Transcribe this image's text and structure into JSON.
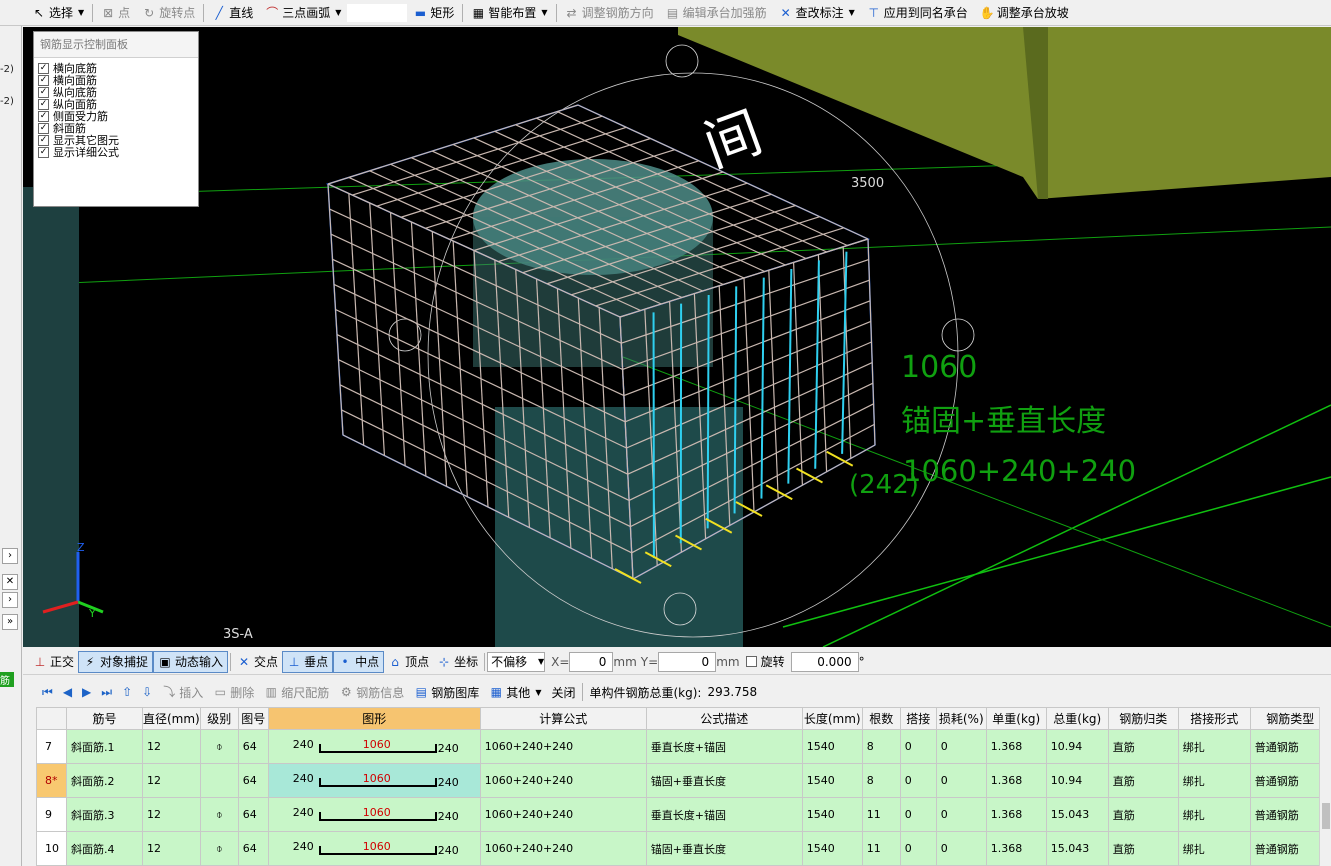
{
  "toolbar": {
    "select": "选择",
    "point": "点",
    "rotate_point": "旋转点",
    "line": "直线",
    "arc3": "三点画弧",
    "rect": "矩形",
    "smart_layout": "智能布置",
    "adjust_dir": "调整钢筋方向",
    "edit_cap_rebar": "编辑承台加强筋",
    "check_label": "查改标注",
    "apply_same": "应用到同名承台",
    "adjust_slope": "调整承台放坡"
  },
  "left_strip": {
    "stub1": "-2)",
    "stub2": "-2)",
    "stub3": "筋"
  },
  "panel": {
    "title": "钢筋显示控制面板",
    "items": [
      {
        "label": "横向底筋",
        "checked": true
      },
      {
        "label": "横向面筋",
        "checked": true
      },
      {
        "label": "纵向底筋",
        "checked": true
      },
      {
        "label": "纵向面筋",
        "checked": true
      },
      {
        "label": "侧面受力筋",
        "checked": true
      },
      {
        "label": "斜面筋",
        "checked": true
      },
      {
        "label": "显示其它图元",
        "checked": true
      },
      {
        "label": "显示详细公式",
        "checked": true
      }
    ]
  },
  "viewport": {
    "dim_label": "3500",
    "ann_length": "1060",
    "ann_desc": "锚固+垂直长度",
    "ann_formula": "1060+240+240",
    "ann_overlap": "(242)",
    "axis_label": "3S-A",
    "axis_z": "Z",
    "axis_y": "Y",
    "colors": {
      "rebar": "#c9b8b0",
      "highlight_rebar": "#2fd0f0",
      "box_edge": "#1a5ee0",
      "yellow": "#f0e020",
      "green_line": "#10c010",
      "column": "#1e4a4a",
      "olive_block": "#7a8a2a",
      "annotation": "#10a010"
    }
  },
  "snapbar": {
    "ortho": "正交",
    "obj_snap": "对象捕捉",
    "dyn_input": "动态输入",
    "intersection": "交点",
    "perp": "垂点",
    "mid": "中点",
    "vertex": "顶点",
    "coord": "坐标",
    "offset": "不偏移",
    "x_label": "X=",
    "x_val": "0",
    "mm1": "mm",
    "y_label": "Y=",
    "y_val": "0",
    "mm2": "mm",
    "rotate": "旋转",
    "rotate_val": "0.000",
    "deg": "°"
  },
  "navbar": {
    "insert": "插入",
    "delete": "删除",
    "scale_rebar": "缩尺配筋",
    "rebar_info": "钢筋信息",
    "rebar_lib": "钢筋图库",
    "other": "其他",
    "close": "关闭",
    "total_label": "单构件钢筋总重(kg):",
    "total_value": "293.758"
  },
  "table": {
    "headers": [
      "",
      "筋号",
      "直径(mm)",
      "级别",
      "图号",
      "图形",
      "计算公式",
      "公式描述",
      "长度(mm)",
      "根数",
      "搭接",
      "损耗(%)",
      "单重(kg)",
      "总重(kg)",
      "钢筋归类",
      "搭接形式",
      "钢筋类型"
    ],
    "rows": [
      {
        "num": "7",
        "name": "斜面筋.1",
        "dia": "12",
        "grade": "⌽",
        "fig": "64",
        "s_left": "240",
        "s_mid": "1060",
        "s_right": "240",
        "formula": "1060+240+240",
        "desc": "垂直长度+锚固",
        "length": "1540",
        "count": "8",
        "lap": "0",
        "loss": "0",
        "unit_w": "1.368",
        "total_w": "10.94",
        "category": "直筋",
        "lap_type": "绑扎",
        "type": "普通钢筋",
        "current": false
      },
      {
        "num": "8*",
        "name": "斜面筋.2",
        "dia": "12",
        "grade": "",
        "fig": "64",
        "s_left": "240",
        "s_mid": "1060",
        "s_right": "240",
        "formula": "1060+240+240",
        "desc": "锚固+垂直长度",
        "length": "1540",
        "count": "8",
        "lap": "0",
        "loss": "0",
        "unit_w": "1.368",
        "total_w": "10.94",
        "category": "直筋",
        "lap_type": "绑扎",
        "type": "普通钢筋",
        "current": true
      },
      {
        "num": "9",
        "name": "斜面筋.3",
        "dia": "12",
        "grade": "⌽",
        "fig": "64",
        "s_left": "240",
        "s_mid": "1060",
        "s_right": "240",
        "formula": "1060+240+240",
        "desc": "垂直长度+锚固",
        "length": "1540",
        "count": "11",
        "lap": "0",
        "loss": "0",
        "unit_w": "1.368",
        "total_w": "15.043",
        "category": "直筋",
        "lap_type": "绑扎",
        "type": "普通钢筋",
        "current": false
      },
      {
        "num": "10",
        "name": "斜面筋.4",
        "dia": "12",
        "grade": "⌽",
        "fig": "64",
        "s_left": "240",
        "s_mid": "1060",
        "s_right": "240",
        "formula": "1060+240+240",
        "desc": "锚固+垂直长度",
        "length": "1540",
        "count": "11",
        "lap": "0",
        "loss": "0",
        "unit_w": "1.368",
        "total_w": "15.043",
        "category": "直筋",
        "lap_type": "绑扎",
        "type": "普通钢筋",
        "current": false
      }
    ]
  }
}
